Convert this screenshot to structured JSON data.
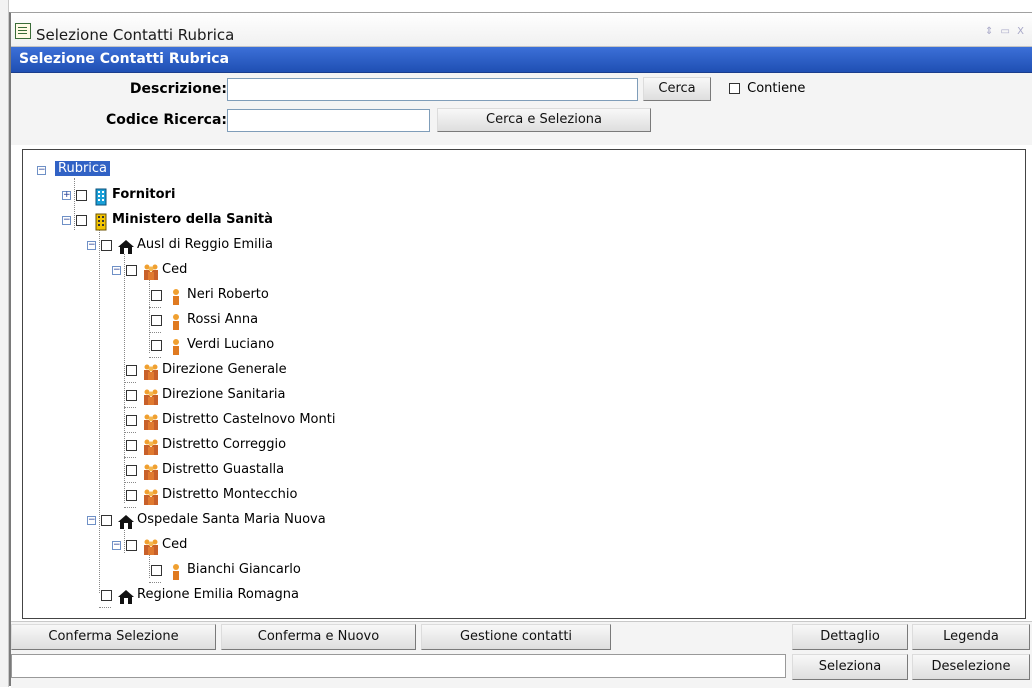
{
  "window": {
    "title": "Selezione Contatti Rubrica",
    "controls": "⇕ ▭ X"
  },
  "panel": {
    "title": "Selezione Contatti Rubrica"
  },
  "search": {
    "descrizione_label": "Descrizione:",
    "descrizione_value": "",
    "cerca_label": "Cerca",
    "contiene_label": "Contiene",
    "contiene_checked": false,
    "codice_label": "Codice Ricerca:",
    "codice_value": "",
    "cerca_seleziona_label": "Cerca e Seleziona"
  },
  "tree": {
    "root": "Rubrica",
    "nodes": [
      {
        "label": "Fornitori",
        "icon": "building-blue-icon",
        "bold": true,
        "expander": "plus"
      },
      {
        "label": "Ministero della Sanità",
        "icon": "building-yellow-icon",
        "bold": true,
        "expander": "minus"
      },
      {
        "label": "Ausl di Reggio Emilia",
        "icon": "house-icon",
        "bold": false,
        "expander": "minus"
      },
      {
        "label": "Ced",
        "icon": "group-icon",
        "bold": false,
        "expander": "minus"
      },
      {
        "label": "Neri Roberto",
        "icon": "person-icon",
        "bold": false
      },
      {
        "label": "Rossi Anna",
        "icon": "person-icon",
        "bold": false
      },
      {
        "label": "Verdi Luciano",
        "icon": "person-icon",
        "bold": false
      },
      {
        "label": "Direzione Generale",
        "icon": "group-icon",
        "bold": false
      },
      {
        "label": "Direzione Sanitaria",
        "icon": "group-icon",
        "bold": false
      },
      {
        "label": "Distretto Castelnovo Monti",
        "icon": "group-icon",
        "bold": false
      },
      {
        "label": "Distretto Correggio",
        "icon": "group-icon",
        "bold": false
      },
      {
        "label": "Distretto Guastalla",
        "icon": "group-icon",
        "bold": false
      },
      {
        "label": "Distretto Montecchio",
        "icon": "group-icon",
        "bold": false
      },
      {
        "label": "Ospedale Santa Maria Nuova",
        "icon": "house-icon",
        "bold": false,
        "expander": "minus"
      },
      {
        "label": "Ced",
        "icon": "group-icon",
        "bold": false,
        "expander": "minus"
      },
      {
        "label": "Bianchi Giancarlo",
        "icon": "person-icon",
        "bold": false
      },
      {
        "label": "Regione Emilia Romagna",
        "icon": "house-icon",
        "bold": false
      }
    ]
  },
  "buttons": {
    "conferma_selezione": "Conferma Selezione",
    "conferma_nuovo": "Conferma e Nuovo",
    "gestione_contatti": "Gestione contatti",
    "dettaglio": "Dettaglio",
    "legenda": "Legenda",
    "seleziona": "Seleziona",
    "deselezione": "Deselezione"
  },
  "colors": {
    "header_blue": "#2a5cc4",
    "selection_blue": "#3162c5"
  }
}
